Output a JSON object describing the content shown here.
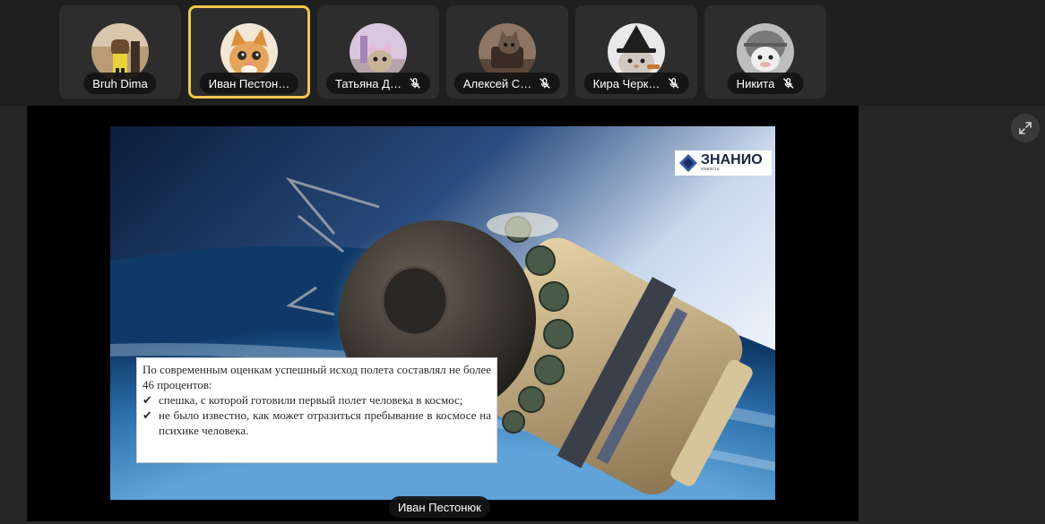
{
  "participants": [
    {
      "name": "Bruh Dima",
      "avatar_icon": "user-avatar-icon",
      "muted": false,
      "active": false
    },
    {
      "name": "Иван Пестон…",
      "avatar_icon": "kitten-avatar-icon",
      "muted": false,
      "active": true
    },
    {
      "name": "Татьяна Д…",
      "avatar_icon": "cat-avatar-icon",
      "muted": true,
      "active": false
    },
    {
      "name": "Алексей С…",
      "avatar_icon": "cat-avatar-icon",
      "muted": true,
      "active": false
    },
    {
      "name": "Кира Черк…",
      "avatar_icon": "cat-avatar-icon",
      "muted": true,
      "active": false
    },
    {
      "name": "Никита",
      "avatar_icon": "cat-avatar-icon",
      "muted": true,
      "active": false
    }
  ],
  "colors": {
    "active_border": "#f3c44e",
    "tile_bg": "#2d2d2d",
    "app_bg": "#1f1f1f"
  },
  "stage": {
    "expand_icon": "expand-icon",
    "presenter_label": "Иван Пестонюк"
  },
  "slide": {
    "logo": {
      "brand": "ЗНАНИО",
      "sub": "znanio.ru"
    },
    "caption": {
      "lead": "По современным оценкам успешный исход полета составлял не более 46 процентов:",
      "bullets": [
        "спешка, с которой готовили первый полет человека в космос;",
        "не было известно, как может отразиться пребывание в космосе на психике человека."
      ]
    }
  }
}
